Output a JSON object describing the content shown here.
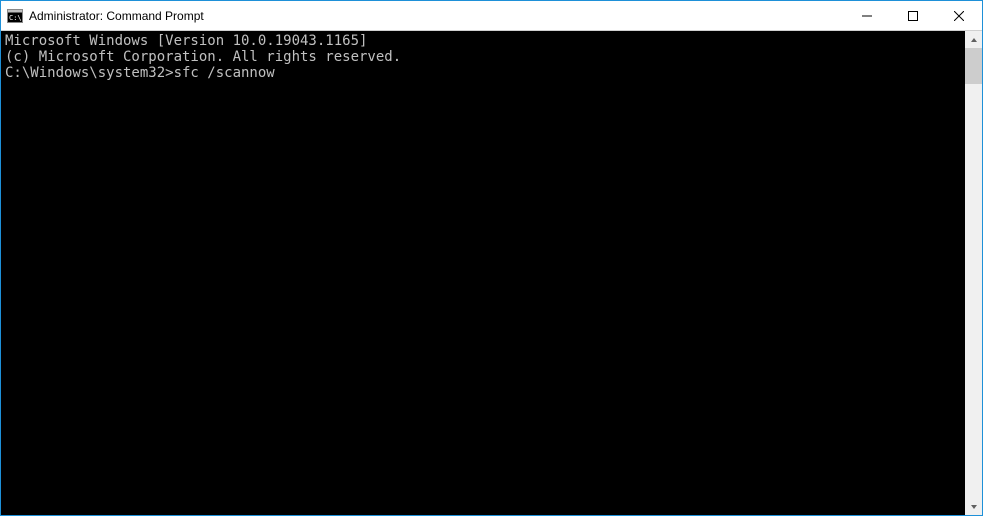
{
  "titlebar": {
    "title": "Administrator: Command Prompt"
  },
  "console": {
    "lines": [
      "Microsoft Windows [Version 10.0.19043.1165]",
      "(c) Microsoft Corporation. All rights reserved.",
      "",
      "C:\\Windows\\system32>sfc /scannow"
    ]
  }
}
